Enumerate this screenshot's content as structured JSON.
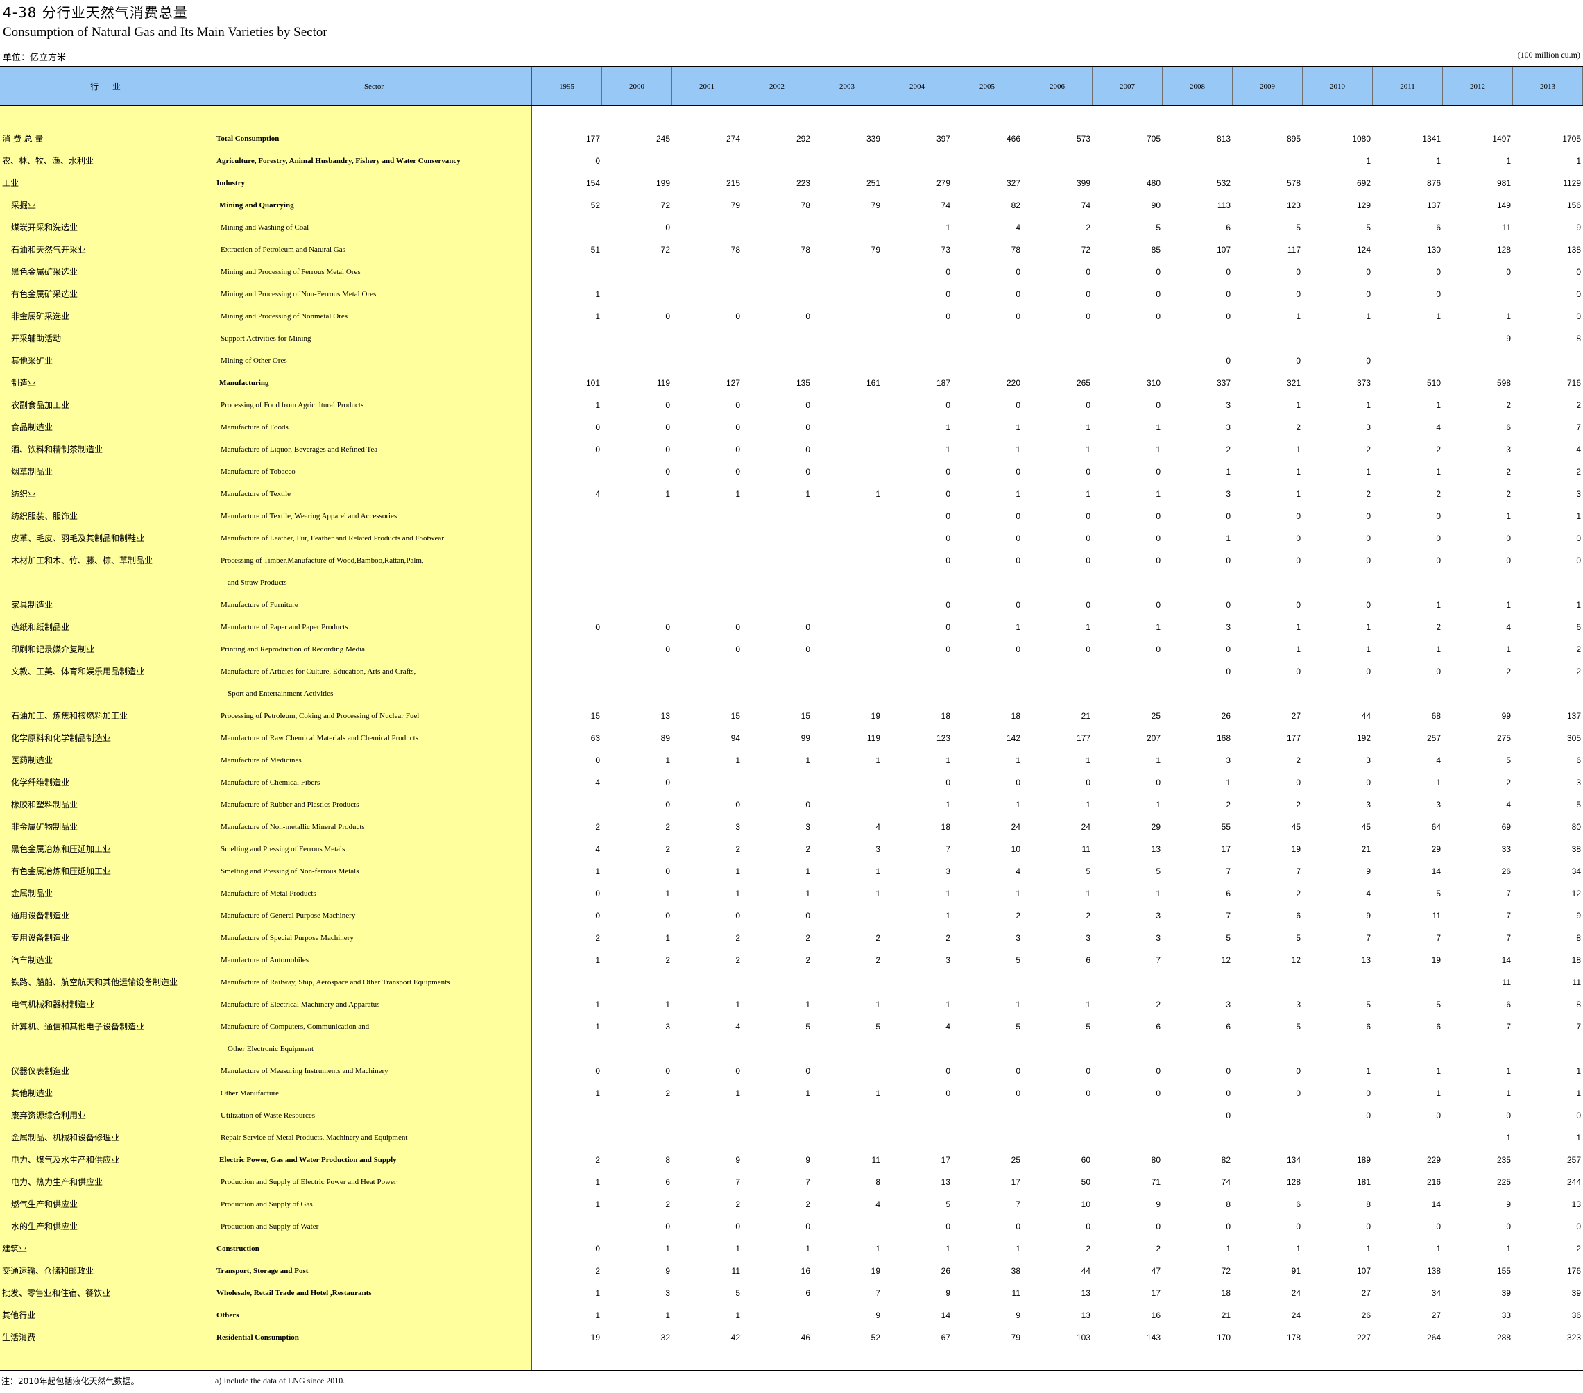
{
  "title_cn": "4-38   分行业天然气消费总量",
  "title_en": "Consumption of Natural Gas and Its Main Varieties by Sector",
  "unit_cn": "单位：亿立方米",
  "unit_en": "(100 million cu.m)",
  "header": {
    "sector_cn": "行 业",
    "sector_en": "Sector",
    "years": [
      "1995",
      "2000",
      "2001",
      "2002",
      "2003",
      "2004",
      "2005",
      "2006",
      "2007",
      "2008",
      "2009",
      "2010",
      "2011",
      "2012",
      "2013"
    ]
  },
  "rows": [
    {
      "cn": "消 费 总 量",
      "en": "Total Consumption",
      "level": 0,
      "bold": true,
      "v": [
        "177",
        "245",
        "274",
        "292",
        "339",
        "397",
        "466",
        "573",
        "705",
        "813",
        "895",
        "1080",
        "1341",
        "1497",
        "1705"
      ]
    },
    {
      "cn": "农、林、牧、渔、水利业",
      "en": "Agriculture, Forestry, Animal Husbandry, Fishery and Water Conservancy",
      "level": 0,
      "bold": true,
      "v": [
        "0",
        "",
        "",
        "",
        "",
        "",
        "",
        "",
        "",
        "",
        "",
        "1",
        "1",
        "1",
        "1"
      ]
    },
    {
      "cn": "工业",
      "en": "Industry",
      "level": 0,
      "bold": true,
      "v": [
        "154",
        "199",
        "215",
        "223",
        "251",
        "279",
        "327",
        "399",
        "480",
        "532",
        "578",
        "692",
        "876",
        "981",
        "1129"
      ]
    },
    {
      "cn": "采掘业",
      "en": "Mining and Quarrying",
      "level": 1,
      "bold": true,
      "v": [
        "52",
        "72",
        "79",
        "78",
        "79",
        "74",
        "82",
        "74",
        "90",
        "113",
        "123",
        "129",
        "137",
        "149",
        "156"
      ]
    },
    {
      "cn": "煤炭开采和洗选业",
      "en": "Mining and Washing of Coal",
      "level": 1,
      "bold": false,
      "v": [
        "",
        "0",
        "",
        "",
        "",
        "1",
        "4",
        "2",
        "5",
        "6",
        "5",
        "5",
        "6",
        "11",
        "9"
      ]
    },
    {
      "cn": "石油和天然气开采业",
      "en": "Extraction of Petroleum and Natural Gas",
      "level": 1,
      "bold": false,
      "v": [
        "51",
        "72",
        "78",
        "78",
        "79",
        "73",
        "78",
        "72",
        "85",
        "107",
        "117",
        "124",
        "130",
        "128",
        "138"
      ]
    },
    {
      "cn": "黑色金属矿采选业",
      "en": "Mining and Processing of Ferrous Metal Ores",
      "level": 1,
      "bold": false,
      "v": [
        "",
        "",
        "",
        "",
        "",
        "0",
        "0",
        "0",
        "0",
        "0",
        "0",
        "0",
        "0",
        "0",
        "0"
      ]
    },
    {
      "cn": "有色金属矿采选业",
      "en": "Mining and Processing of Non-Ferrous Metal Ores",
      "level": 1,
      "bold": false,
      "v": [
        "1",
        "",
        "",
        "",
        "",
        "0",
        "0",
        "0",
        "0",
        "0",
        "0",
        "0",
        "0",
        "",
        "0"
      ]
    },
    {
      "cn": "非金属矿采选业",
      "en": "Mining and Processing of Nonmetal Ores",
      "level": 1,
      "bold": false,
      "v": [
        "1",
        "0",
        "0",
        "0",
        "",
        "0",
        "0",
        "0",
        "0",
        "0",
        "1",
        "1",
        "1",
        "1",
        "0"
      ]
    },
    {
      "cn": "开采辅助活动",
      "en": "Support Activities for Mining",
      "level": 1,
      "bold": false,
      "v": [
        "",
        "",
        "",
        "",
        "",
        "",
        "",
        "",
        "",
        "",
        "",
        "",
        "",
        "9",
        "8"
      ]
    },
    {
      "cn": "其他采矿业",
      "en": "Mining of Other Ores",
      "level": 1,
      "bold": false,
      "v": [
        "",
        "",
        "",
        "",
        "",
        "",
        "",
        "",
        "",
        "0",
        "0",
        "0",
        "",
        "",
        ""
      ]
    },
    {
      "cn": "制造业",
      "en": "Manufacturing",
      "level": 1,
      "bold": true,
      "v": [
        "101",
        "119",
        "127",
        "135",
        "161",
        "187",
        "220",
        "265",
        "310",
        "337",
        "321",
        "373",
        "510",
        "598",
        "716"
      ]
    },
    {
      "cn": "农副食品加工业",
      "en": "Processing of Food from Agricultural Products",
      "level": 1,
      "bold": false,
      "v": [
        "1",
        "0",
        "0",
        "0",
        "",
        "0",
        "0",
        "0",
        "0",
        "3",
        "1",
        "1",
        "1",
        "2",
        "2"
      ]
    },
    {
      "cn": "食品制造业",
      "en": "Manufacture of Foods",
      "level": 1,
      "bold": false,
      "v": [
        "0",
        "0",
        "0",
        "0",
        "",
        "1",
        "1",
        "1",
        "1",
        "3",
        "2",
        "3",
        "4",
        "6",
        "7"
      ]
    },
    {
      "cn": "酒、饮料和精制茶制造业",
      "en": "Manufacture of Liquor, Beverages and Refined Tea",
      "level": 1,
      "bold": false,
      "v": [
        "0",
        "0",
        "0",
        "0",
        "",
        "1",
        "1",
        "1",
        "1",
        "2",
        "1",
        "2",
        "2",
        "3",
        "4"
      ]
    },
    {
      "cn": "烟草制品业",
      "en": "Manufacture of Tobacco",
      "level": 1,
      "bold": false,
      "v": [
        "",
        "0",
        "0",
        "0",
        "",
        "0",
        "0",
        "0",
        "0",
        "1",
        "1",
        "1",
        "1",
        "2",
        "2"
      ]
    },
    {
      "cn": "纺织业",
      "en": "Manufacture of  Textile",
      "level": 1,
      "bold": false,
      "v": [
        "4",
        "1",
        "1",
        "1",
        "1",
        "0",
        "1",
        "1",
        "1",
        "3",
        "1",
        "2",
        "2",
        "2",
        "3"
      ]
    },
    {
      "cn": "纺织服装、服饰业",
      "en": "Manufacture of Textile, Wearing Apparel and Accessories",
      "level": 1,
      "bold": false,
      "v": [
        "",
        "",
        "",
        "",
        "",
        "0",
        "0",
        "0",
        "0",
        "0",
        "0",
        "0",
        "0",
        "1",
        "1"
      ]
    },
    {
      "cn": "皮革、毛皮、羽毛及其制品和制鞋业",
      "en": "Manufacture of Leather, Fur, Feather and Related Products and Footwear",
      "level": 1,
      "bold": false,
      "v": [
        "",
        "",
        "",
        "",
        "",
        "0",
        "0",
        "0",
        "0",
        "1",
        "0",
        "0",
        "0",
        "0",
        "0"
      ]
    },
    {
      "cn": "木材加工和木、竹、藤、棕、草制品业",
      "en": "Processing of Timber,Manufacture of  Wood,Bamboo,Rattan,Palm,",
      "level": 1,
      "bold": false,
      "v": [
        "",
        "",
        "",
        "",
        "",
        "0",
        "0",
        "0",
        "0",
        "0",
        "0",
        "0",
        "0",
        "0",
        "0"
      ]
    },
    {
      "cn": "",
      "en": "and Straw Products",
      "level": 2,
      "bold": false,
      "v": [
        "",
        "",
        "",
        "",
        "",
        "",
        "",
        "",
        "",
        "",
        "",
        "",
        "",
        "",
        ""
      ]
    },
    {
      "cn": "家具制造业",
      "en": "Manufacture of Furniture",
      "level": 1,
      "bold": false,
      "v": [
        "",
        "",
        "",
        "",
        "",
        "0",
        "0",
        "0",
        "0",
        "0",
        "0",
        "0",
        "1",
        "1",
        "1"
      ]
    },
    {
      "cn": "造纸和纸制品业",
      "en": "Manufacture of  Paper and Paper Products",
      "level": 1,
      "bold": false,
      "v": [
        "0",
        "0",
        "0",
        "0",
        "",
        "0",
        "1",
        "1",
        "1",
        "3",
        "1",
        "1",
        "2",
        "4",
        "6"
      ]
    },
    {
      "cn": "印刷和记录媒介复制业",
      "en": "Printing and Reproduction of Recording Media",
      "level": 1,
      "bold": false,
      "v": [
        "",
        "0",
        "0",
        "0",
        "",
        "0",
        "0",
        "0",
        "0",
        "0",
        "1",
        "1",
        "1",
        "1",
        "2"
      ]
    },
    {
      "cn": "文教、工美、体育和娱乐用品制造业",
      "en": "Manufacture of Articles for Culture, Education, Arts and Crafts,",
      "level": 1,
      "bold": false,
      "v": [
        "",
        "",
        "",
        "",
        "",
        "",
        "",
        "",
        "",
        "0",
        "0",
        "0",
        "0",
        "2",
        "2"
      ]
    },
    {
      "cn": "",
      "en": "Sport and Entertainment Activities",
      "level": 2,
      "bold": false,
      "v": [
        "",
        "",
        "",
        "",
        "",
        "",
        "",
        "",
        "",
        "",
        "",
        "",
        "",
        "",
        ""
      ]
    },
    {
      "cn": "石油加工、炼焦和核燃料加工业",
      "en": "Processing of Petroleum, Coking and Processing of Nuclear Fuel",
      "level": 1,
      "bold": false,
      "v": [
        "15",
        "13",
        "15",
        "15",
        "19",
        "18",
        "18",
        "21",
        "25",
        "26",
        "27",
        "44",
        "68",
        "99",
        "137"
      ]
    },
    {
      "cn": "化学原料和化学制品制造业",
      "en": "Manufacture of Raw Chemical Materials and Chemical Products",
      "level": 1,
      "bold": false,
      "v": [
        "63",
        "89",
        "94",
        "99",
        "119",
        "123",
        "142",
        "177",
        "207",
        "168",
        "177",
        "192",
        "257",
        "275",
        "305"
      ]
    },
    {
      "cn": "医药制造业",
      "en": "Manufacture of Medicines",
      "level": 1,
      "bold": false,
      "v": [
        "0",
        "1",
        "1",
        "1",
        "1",
        "1",
        "1",
        "1",
        "1",
        "3",
        "2",
        "3",
        "4",
        "5",
        "6"
      ]
    },
    {
      "cn": "化学纤维制造业",
      "en": "Manufacture of Chemical Fibers",
      "level": 1,
      "bold": false,
      "v": [
        "4",
        "0",
        "",
        "",
        "",
        "0",
        "0",
        "0",
        "0",
        "1",
        "0",
        "0",
        "1",
        "2",
        "3"
      ]
    },
    {
      "cn": "橡胶和塑料制品业",
      "en": "Manufacture of Rubber and Plastics Products",
      "level": 1,
      "bold": false,
      "v": [
        "",
        "0",
        "0",
        "0",
        "",
        "1",
        "1",
        "1",
        "1",
        "2",
        "2",
        "3",
        "3",
        "4",
        "5"
      ]
    },
    {
      "cn": "非金属矿物制品业",
      "en": "Manufacture of Non-metallic Mineral Products",
      "level": 1,
      "bold": false,
      "v": [
        "2",
        "2",
        "3",
        "3",
        "4",
        "18",
        "24",
        "24",
        "29",
        "55",
        "45",
        "45",
        "64",
        "69",
        "80"
      ]
    },
    {
      "cn": "黑色金属冶炼和压延加工业",
      "en": "Smelting and Pressing of Ferrous Metals",
      "level": 1,
      "bold": false,
      "v": [
        "4",
        "2",
        "2",
        "2",
        "3",
        "7",
        "10",
        "11",
        "13",
        "17",
        "19",
        "21",
        "29",
        "33",
        "38"
      ]
    },
    {
      "cn": "有色金属冶炼和压延加工业",
      "en": "Smelting and Pressing of Non-ferrous Metals",
      "level": 1,
      "bold": false,
      "v": [
        "1",
        "0",
        "1",
        "1",
        "1",
        "3",
        "4",
        "5",
        "5",
        "7",
        "7",
        "9",
        "14",
        "26",
        "34"
      ]
    },
    {
      "cn": "金属制品业",
      "en": "Manufacture of Metal Products",
      "level": 1,
      "bold": false,
      "v": [
        "0",
        "1",
        "1",
        "1",
        "1",
        "1",
        "1",
        "1",
        "1",
        "6",
        "2",
        "4",
        "5",
        "7",
        "12"
      ]
    },
    {
      "cn": "通用设备制造业",
      "en": "Manufacture of General Purpose Machinery",
      "level": 1,
      "bold": false,
      "v": [
        "0",
        "0",
        "0",
        "0",
        "",
        "1",
        "2",
        "2",
        "3",
        "7",
        "6",
        "9",
        "11",
        "7",
        "9"
      ]
    },
    {
      "cn": "专用设备制造业",
      "en": "Manufacture of Special Purpose Machinery",
      "level": 1,
      "bold": false,
      "v": [
        "2",
        "1",
        "2",
        "2",
        "2",
        "2",
        "3",
        "3",
        "3",
        "5",
        "5",
        "7",
        "7",
        "7",
        "8"
      ]
    },
    {
      "cn": "汽车制造业",
      "en": "Manufacture of Automobiles",
      "level": 1,
      "bold": false,
      "v": [
        "1",
        "2",
        "2",
        "2",
        "2",
        "3",
        "5",
        "6",
        "7",
        "12",
        "12",
        "13",
        "19",
        "14",
        "18"
      ]
    },
    {
      "cn": "铁路、船舶、航空航天和其他运输设备制造业",
      "en": "Manufacture of Railway, Ship, Aerospace and Other Transport Equipments",
      "level": 1,
      "bold": false,
      "v": [
        "",
        "",
        "",
        "",
        "",
        "",
        "",
        "",
        "",
        "",
        "",
        "",
        "",
        "11",
        "11"
      ]
    },
    {
      "cn": "电气机械和器材制造业",
      "en": "Manufacture of Electrical Machinery and Apparatus",
      "level": 1,
      "bold": false,
      "v": [
        "1",
        "1",
        "1",
        "1",
        "1",
        "1",
        "1",
        "1",
        "2",
        "3",
        "3",
        "5",
        "5",
        "6",
        "8"
      ]
    },
    {
      "cn": "计算机、通信和其他电子设备制造业",
      "en": "Manufacture of Computers, Communication and",
      "level": 1,
      "bold": false,
      "v": [
        "1",
        "3",
        "4",
        "5",
        "5",
        "4",
        "5",
        "5",
        "6",
        "6",
        "5",
        "6",
        "6",
        "7",
        "7"
      ]
    },
    {
      "cn": "",
      "en": "Other Electronic Equipment",
      "level": 2,
      "bold": false,
      "v": [
        "",
        "",
        "",
        "",
        "",
        "",
        "",
        "",
        "",
        "",
        "",
        "",
        "",
        "",
        ""
      ]
    },
    {
      "cn": "仪器仪表制造业",
      "en": "Manufacture of Measuring Instruments and Machinery",
      "level": 1,
      "bold": false,
      "v": [
        "0",
        "0",
        "0",
        "0",
        "",
        "0",
        "0",
        "0",
        "0",
        "0",
        "0",
        "1",
        "1",
        "1",
        "1"
      ]
    },
    {
      "cn": "其他制造业",
      "en": "Other Manufacture",
      "level": 1,
      "bold": false,
      "v": [
        "1",
        "2",
        "1",
        "1",
        "1",
        "0",
        "0",
        "0",
        "0",
        "0",
        "0",
        "0",
        "1",
        "1",
        "1"
      ]
    },
    {
      "cn": "废弃资源综合利用业",
      "en": "Utilization of Waste Resources",
      "level": 1,
      "bold": false,
      "v": [
        "",
        "",
        "",
        "",
        "",
        "",
        "",
        "",
        "",
        "0",
        "",
        "0",
        "0",
        "0",
        "0"
      ]
    },
    {
      "cn": "金属制品、机械和设备修理业",
      "en": "Repair Service of Metal Products, Machinery and Equipment",
      "level": 1,
      "bold": false,
      "v": [
        "",
        "",
        "",
        "",
        "",
        "",
        "",
        "",
        "",
        "",
        "",
        "",
        "",
        "1",
        "1"
      ]
    },
    {
      "cn": "电力、煤气及水生产和供应业",
      "en": "Electric Power, Gas and Water Production and Supply",
      "level": 1,
      "bold": true,
      "v": [
        "2",
        "8",
        "9",
        "9",
        "11",
        "17",
        "25",
        "60",
        "80",
        "82",
        "134",
        "189",
        "229",
        "235",
        "257"
      ]
    },
    {
      "cn": "电力、热力生产和供应业",
      "en": "Production and Supply of Electric Power and Heat Power",
      "level": 1,
      "bold": false,
      "v": [
        "1",
        "6",
        "7",
        "7",
        "8",
        "13",
        "17",
        "50",
        "71",
        "74",
        "128",
        "181",
        "216",
        "225",
        "244"
      ]
    },
    {
      "cn": "燃气生产和供应业",
      "en": "Production and Supply of Gas",
      "level": 1,
      "bold": false,
      "v": [
        "1",
        "2",
        "2",
        "2",
        "4",
        "5",
        "7",
        "10",
        "9",
        "8",
        "6",
        "8",
        "14",
        "9",
        "13"
      ]
    },
    {
      "cn": "水的生产和供应业",
      "en": "Production and Supply of Water",
      "level": 1,
      "bold": false,
      "v": [
        "",
        "0",
        "0",
        "0",
        "",
        "0",
        "0",
        "0",
        "0",
        "0",
        "0",
        "0",
        "0",
        "0",
        "0"
      ]
    },
    {
      "cn": "建筑业",
      "en": "Construction",
      "level": 0,
      "bold": true,
      "v": [
        "0",
        "1",
        "1",
        "1",
        "1",
        "1",
        "1",
        "2",
        "2",
        "1",
        "1",
        "1",
        "1",
        "1",
        "2"
      ]
    },
    {
      "cn": "交通运输、仓储和邮政业",
      "en": "Transport, Storage and Post",
      "level": 0,
      "bold": true,
      "v": [
        "2",
        "9",
        "11",
        "16",
        "19",
        "26",
        "38",
        "44",
        "47",
        "72",
        "91",
        "107",
        "138",
        "155",
        "176"
      ]
    },
    {
      "cn": "批发、零售业和住宿、餐饮业",
      "en": "Wholesale, Retail Trade and Hotel ,Restaurants",
      "level": 0,
      "bold": true,
      "v": [
        "1",
        "3",
        "5",
        "6",
        "7",
        "9",
        "11",
        "13",
        "17",
        "18",
        "24",
        "27",
        "34",
        "39",
        "39"
      ]
    },
    {
      "cn": "其他行业",
      "en": "Others",
      "level": 0,
      "bold": true,
      "v": [
        "1",
        "1",
        "1",
        "",
        "9",
        "14",
        "9",
        "13",
        "16",
        "21",
        "24",
        "26",
        "27",
        "33",
        "36"
      ]
    },
    {
      "cn": "生活消费",
      "en": "Residential Consumption",
      "level": 0,
      "bold": true,
      "v": [
        "19",
        "32",
        "42",
        "46",
        "52",
        "67",
        "79",
        "103",
        "143",
        "170",
        "178",
        "227",
        "264",
        "288",
        "323"
      ]
    }
  ],
  "note_cn": "注：2010年起包括液化天然气数据。",
  "note_en": "a) Include the data of LNG since 2010."
}
